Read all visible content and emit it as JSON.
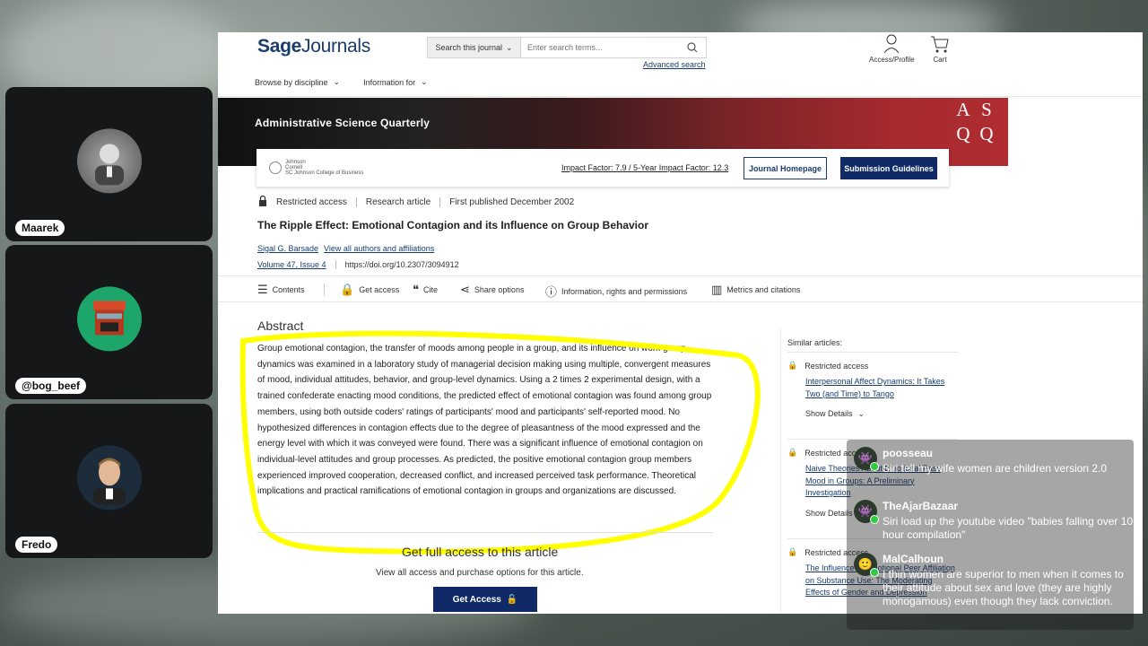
{
  "participants": [
    {
      "name": "Maarek",
      "avatar": "grey-portrait"
    },
    {
      "name": "@bog_beef",
      "avatar": "pixel-face"
    },
    {
      "name": "Fredo",
      "avatar": "man-portrait"
    }
  ],
  "header": {
    "logo_bold": "Sage",
    "logo_rest": "Journals",
    "search_scope": "Search this journal",
    "search_placeholder": "Enter search terms...",
    "advanced_search": "Advanced search",
    "access_label": "Access/Profile",
    "cart_label": "Cart"
  },
  "subnav": {
    "browse": "Browse by discipline",
    "info": "Information for"
  },
  "banner": {
    "title": "Administrative Science Quarterly",
    "asq": [
      "A",
      "S",
      "Q",
      ""
    ]
  },
  "journal_bar": {
    "johnson_line1": "Johnson",
    "johnson_line2": "Cornell",
    "johnson_line3": "SC Johnson College of Business",
    "impact": "Impact Factor: 7.9 / 5-Year Impact Factor: 12.3",
    "home_button": "Journal Homepage",
    "guidelines_button": "Submission Guidelines"
  },
  "article": {
    "access": "Restricted access",
    "type": "Research article",
    "published": "First published December 2002",
    "title": "The Ripple Effect: Emotional Contagion and its Influence on Group Behavior",
    "author": "Sigal G. Barsade",
    "all_authors": "View all authors and affiliations",
    "volume": "Volume 47, Issue 4",
    "doi": "https://doi.org/10.2307/3094912"
  },
  "tabs": {
    "contents": "Contents",
    "get_access": "Get access",
    "cite": "Cite",
    "share": "Share options",
    "info": "Information, rights and permissions",
    "metrics": "Metrics and citations"
  },
  "abstract": {
    "heading": "Abstract",
    "text": "Group emotional contagion, the transfer of moods among people in a group, and its influence on work group dynamics was examined in a laboratory study of managerial decision making using multiple, convergent measures of mood, individual attitudes, behavior, and group-level dynamics. Using a 2 times 2 experimental design, with a trained confederate enacting mood conditions, the predicted effect of emotional contagion was found among group members, using both outside coders' ratings of participants' mood and participants' self-reported mood. No hypothesized differences in contagion effects due to the degree of pleasantness of the mood expressed and the energy level with which it was conveyed were found. There was a significant influence of emotional contagion on individual-level attitudes and group processes. As predicted, the positive emotional contagion group members experienced improved cooperation, decreased conflict, and increased perceived task performance. Theoretical implications and practical ramifications of emotional contagion in groups and organizations are discussed."
  },
  "access_box": {
    "heading": "Get full access to this article",
    "sub": "View all access and purchase options for this article.",
    "button": "Get Access"
  },
  "similar": {
    "heading": "Similar articles:",
    "items": [
      {
        "access": "Restricted access",
        "title": "Interpersonal Affect Dynamics: It Takes Two (and Time) to Tango",
        "details": "Show Details"
      },
      {
        "access": "Restricted access",
        "title": "Naive Theories About Emotional Pass Mood in Groups: A Preliminary Investigation",
        "details": "Show Details"
      },
      {
        "access": "Restricted access",
        "title": "The Influence of Emotional Peer Affiliation on Substance Use: The Moderating Effects of Gender and Depression",
        "details": ""
      }
    ]
  },
  "chat": [
    {
      "user": "poosseau",
      "text": "Siri tell my wife women are children version 2.0"
    },
    {
      "user": "TheAjarBazaar",
      "text": "Siri load up the youtube video \"babies falling over 10 hour compilation\""
    },
    {
      "user": "MalCalhoun",
      "text": "I thin women are superior to men when it comes to their attitude about sex and love (they are highly monogamous) even though they lack conviction."
    }
  ],
  "colors": {
    "brand": "#1a3d6e",
    "button": "#0f2a66",
    "highlight": "#ffff00"
  }
}
